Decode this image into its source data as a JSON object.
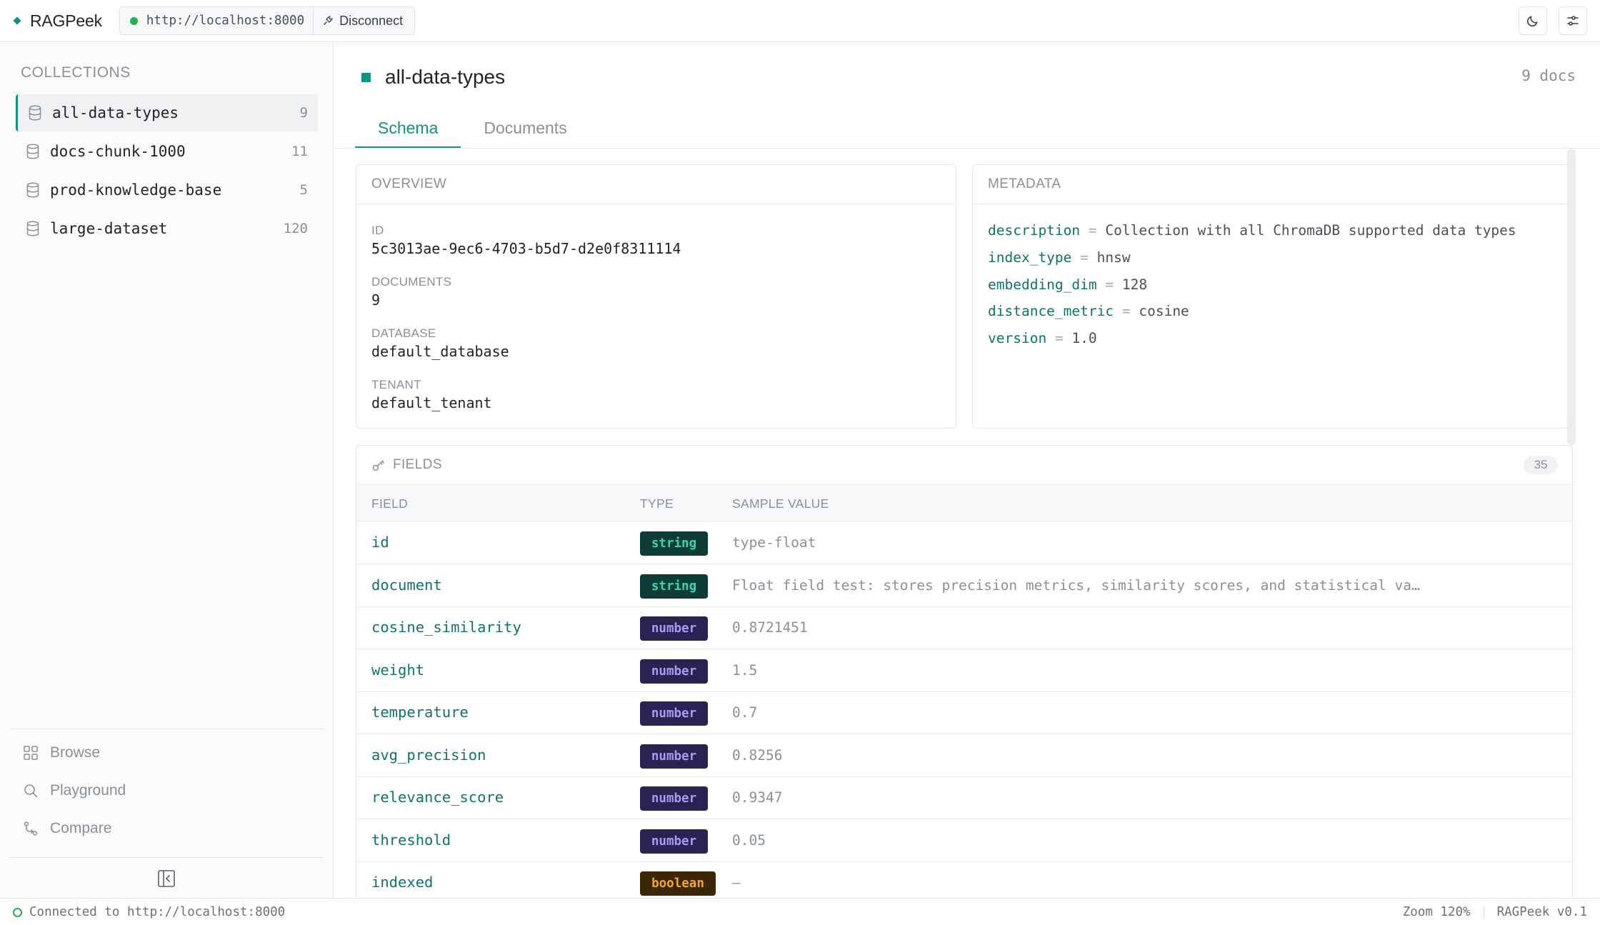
{
  "app": {
    "name": "RAGPeek",
    "server_url": "http://localhost:8000",
    "disconnect_label": "Disconnect",
    "accent_color": "#12937f",
    "connected_color": "#22b14c"
  },
  "sidebar": {
    "heading": "COLLECTIONS",
    "collections": [
      {
        "name": "all-data-types",
        "count": "9",
        "active": true
      },
      {
        "name": "docs-chunk-1000",
        "count": "11"
      },
      {
        "name": "prod-knowledge-base",
        "count": "5"
      },
      {
        "name": "large-dataset",
        "count": "120"
      }
    ],
    "nav": [
      {
        "label": "Browse",
        "icon": "grid-icon"
      },
      {
        "label": "Playground",
        "icon": "search-icon"
      },
      {
        "label": "Compare",
        "icon": "compare-icon"
      }
    ]
  },
  "main": {
    "collection_name": "all-data-types",
    "docs_count": "9 docs",
    "tabs": [
      {
        "label": "Schema",
        "active": true
      },
      {
        "label": "Documents"
      }
    ],
    "overview": {
      "heading": "OVERVIEW",
      "items": [
        {
          "label": "ID",
          "value": "5c3013ae-9ec6-4703-b5d7-d2e0f8311114"
        },
        {
          "label": "DOCUMENTS",
          "value": "9"
        },
        {
          "label": "DATABASE",
          "value": "default_database"
        },
        {
          "label": "TENANT",
          "value": "default_tenant"
        }
      ]
    },
    "metadata": {
      "heading": "METADATA",
      "rows": [
        {
          "key": "description",
          "eq": "=",
          "value": "Collection with all ChromaDB supported data types"
        },
        {
          "key": "index_type",
          "eq": "=",
          "value": "hnsw"
        },
        {
          "key": "embedding_dim",
          "eq": "=",
          "value": "128"
        },
        {
          "key": "distance_metric",
          "eq": "=",
          "value": "cosine"
        },
        {
          "key": "version",
          "eq": "=",
          "value": "1.0"
        }
      ]
    },
    "fields": {
      "heading": "FIELDS",
      "count": "35",
      "columns": [
        "FIELD",
        "TYPE",
        "SAMPLE VALUE"
      ],
      "rows": [
        {
          "field": "id",
          "type": "string",
          "sample": "type-float"
        },
        {
          "field": "document",
          "type": "string",
          "sample": "Float field test: stores precision metrics, similarity scores, and statistical val…"
        },
        {
          "field": "cosine_similarity",
          "type": "number",
          "sample": "0.8721451"
        },
        {
          "field": "weight",
          "type": "number",
          "sample": "1.5"
        },
        {
          "field": "temperature",
          "type": "number",
          "sample": "0.7"
        },
        {
          "field": "avg_precision",
          "type": "number",
          "sample": "0.8256"
        },
        {
          "field": "relevance_score",
          "type": "number",
          "sample": "0.9347"
        },
        {
          "field": "threshold",
          "type": "number",
          "sample": "0.05"
        },
        {
          "field": "indexed",
          "type": "boolean",
          "sample": "–"
        }
      ]
    }
  },
  "status": {
    "connection": "Connected to http://localhost:8000",
    "zoom": "Zoom 120%",
    "version": "RAGPeek v0.1"
  }
}
